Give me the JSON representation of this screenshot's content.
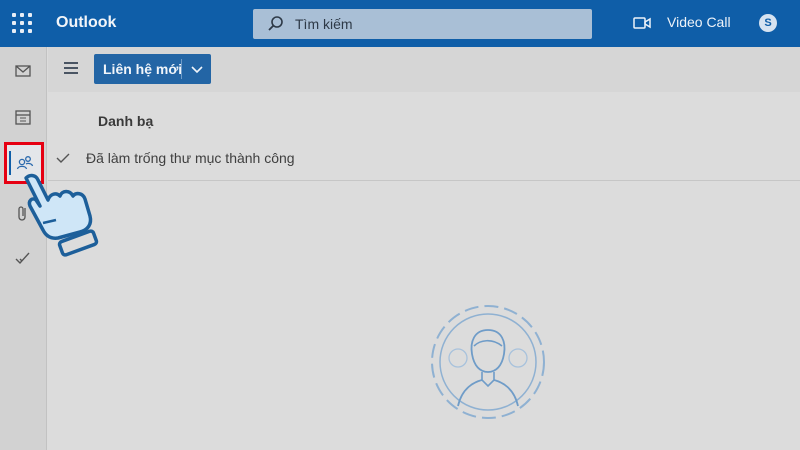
{
  "header": {
    "app_title": "Outlook",
    "search_placeholder": "Tìm kiếm",
    "video_call_label": "Video Call",
    "skype_glyph": "S"
  },
  "rail": {
    "items": [
      {
        "name": "mail-icon",
        "active": false
      },
      {
        "name": "calendar-icon",
        "active": false
      },
      {
        "name": "people-icon",
        "active": true
      },
      {
        "name": "attachment-icon",
        "active": false
      },
      {
        "name": "todo-check-icon",
        "active": false
      }
    ],
    "highlight_color": "#e60012"
  },
  "toolbar": {
    "new_contact_label": "Liên hệ mới"
  },
  "main": {
    "section_title": "Danh bạ",
    "status_message": "Đã làm trống thư mục thành công"
  },
  "colors": {
    "brand": "#0f5ea8",
    "button": "#2365a5",
    "illustration": "#7fa6cc"
  }
}
